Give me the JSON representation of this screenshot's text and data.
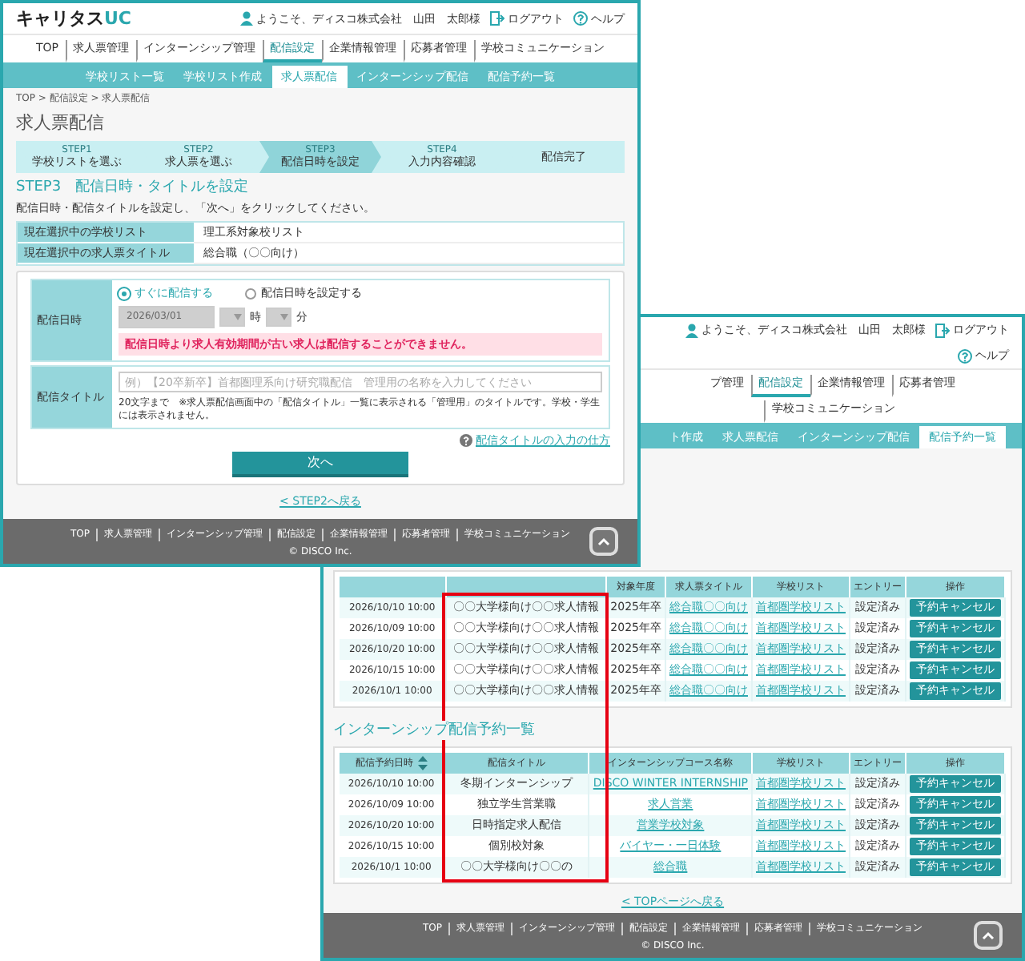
{
  "front_window": {
    "logo": {
      "main": "キャリタス",
      "accent": "UC"
    },
    "user": {
      "greeting": "ようこそ、ディスコ株式会社　山田　太郎様",
      "logout": "ログアウト",
      "help": "ヘルプ"
    },
    "nav": [
      {
        "label": "TOP",
        "selected": false
      },
      {
        "label": "求人票管理",
        "selected": false
      },
      {
        "label": "インターンシップ管理",
        "selected": false
      },
      {
        "label": "配信設定",
        "selected": true
      },
      {
        "label": "企業情報管理",
        "selected": false
      },
      {
        "label": "応募者管理",
        "selected": false
      },
      {
        "label": "学校コミュニケーション",
        "selected": false
      }
    ],
    "subtabs": [
      {
        "label": "学校リスト一覧",
        "selected": false
      },
      {
        "label": "学校リスト作成",
        "selected": false
      },
      {
        "label": "求人票配信",
        "selected": true
      },
      {
        "label": "インターンシップ配信",
        "selected": false
      },
      {
        "label": "配信予約一覧",
        "selected": false
      }
    ],
    "breadcrumb": "TOP > 配信設定 > 求人票配信",
    "title": "求人票配信",
    "steps": [
      {
        "step": "STEP1",
        "label": "学校リストを選ぶ",
        "selected": false
      },
      {
        "step": "STEP2",
        "label": "求人票を選ぶ",
        "selected": false
      },
      {
        "step": "STEP3",
        "label": "配信日時を設定",
        "selected": true
      },
      {
        "step": "STEP4",
        "label": "入力内容確認",
        "selected": false
      },
      {
        "label": "配信完了",
        "selected": false
      }
    ],
    "section_heading": "STEP3　配信日時・タイトルを設定",
    "instruction": "配信日時・配信タイトルを設定し、「次へ」をクリックしてください。",
    "summary": [
      {
        "label": "現在選択中の学校リスト",
        "value": "理工系対象校リスト"
      },
      {
        "label": "現在選択中の求人票タイトル",
        "value": "総合職（〇〇向け）"
      }
    ],
    "form": {
      "date_label": "配信日時",
      "options": [
        {
          "label": "すぐに配信する",
          "selected": true
        },
        {
          "label": "配信日時を設定する",
          "selected": false
        }
      ],
      "date_value": "2026/03/01",
      "hour_unit": "時",
      "minute_unit": "分",
      "disabled": true,
      "error": "配信日時より求人有効期間が古い求人は配信することができません。",
      "title_label": "配信タイトル",
      "title_placeholder": "例）【20卒新卒】首都圏理系向け研究職配信　管理用の名称を入力してください",
      "title_note": "20文字まで　※求人票配信画面中の「配信タイトル」一覧に表示される「管理用」のタイトルです。学校・学生には表示されません。",
      "help_link": "配信タイトルの入力の仕方",
      "submit": "次へ"
    },
    "back_link": "< STEP2へ戻る",
    "footer": {
      "links": [
        "TOP",
        "求人票管理",
        "インターンシップ管理",
        "配信設定",
        "企業情報管理",
        "応募者管理",
        "学校コミュニケーション"
      ],
      "copyright": "© DISCO Inc."
    }
  },
  "back_window": {
    "user": {
      "greeting": "ようこそ、ディスコ株式会社　山田　太郎様",
      "logout": "ログアウト",
      "help": "ヘルプ"
    },
    "nav": [
      {
        "label": "プ管理",
        "selected": false
      },
      {
        "label": "配信設定",
        "selected": true
      },
      {
        "label": "企業情報管理",
        "selected": false
      },
      {
        "label": "応募者管理",
        "selected": false
      },
      {
        "label": "学校コミュニケーション",
        "selected": false
      }
    ],
    "subtabs": [
      {
        "label": "ト作成",
        "selected": false
      },
      {
        "label": "求人票配信",
        "selected": false
      },
      {
        "label": "インターンシップ配信",
        "selected": false
      },
      {
        "label": "配信予約一覧",
        "selected": true
      }
    ],
    "job_reservations": {
      "columns": [
        "",
        "",
        "対象年度",
        "求人票タイトル",
        "学校リスト",
        "エントリー",
        "操作"
      ],
      "rows": [
        {
          "cells": [
            "2026/10/10 10:00",
            "〇〇大学様向け〇〇求人情報",
            "2025年卒",
            {
              "kind": "link",
              "text": "総合職〇〇向け"
            },
            {
              "kind": "link",
              "text": "首都圏学校リスト"
            },
            "設定済み"
          ],
          "action": "予約キャンセル"
        },
        {
          "cells": [
            "2026/10/09 10:00",
            "〇〇大学様向け〇〇求人情報",
            "2025年卒",
            {
              "kind": "link",
              "text": "総合職〇〇向け"
            },
            {
              "kind": "link",
              "text": "首都圏学校リスト"
            },
            "設定済み"
          ],
          "action": "予約キャンセル"
        },
        {
          "cells": [
            "2026/10/20 10:00",
            "〇〇大学様向け〇〇求人情報",
            "2025年卒",
            {
              "kind": "link",
              "text": "総合職〇〇向け"
            },
            {
              "kind": "link",
              "text": "首都圏学校リスト"
            },
            "設定済み"
          ],
          "action": "予約キャンセル"
        },
        {
          "cells": [
            "2026/10/15 10:00",
            "〇〇大学様向け〇〇求人情報",
            "2025年卒",
            {
              "kind": "link",
              "text": "総合職〇〇向け"
            },
            {
              "kind": "link",
              "text": "首都圏学校リスト"
            },
            "設定済み"
          ],
          "action": "予約キャンセル"
        },
        {
          "cells": [
            "2026/10/1 10:00",
            "〇〇大学様向け〇〇求人情報",
            "2025年卒",
            {
              "kind": "link",
              "text": "総合職〇〇向け"
            },
            {
              "kind": "link",
              "text": "首都圏学校リスト"
            },
            "設定済み"
          ],
          "action": "予約キャンセル"
        }
      ]
    },
    "internship_heading": "インターンシップ配信予約一覧",
    "internship_reservations": {
      "columns": [
        "配信予約日時",
        "配信タイトル",
        "インターンシップコース名称",
        "学校リスト",
        "エントリー",
        "操作"
      ],
      "rows": [
        {
          "cells": [
            "2026/10/10 10:00",
            "冬期インターンシップ",
            {
              "kind": "link",
              "text": "DISCO WINTER INTERNSHIP"
            },
            {
              "kind": "link",
              "text": "首都圏学校リスト"
            },
            "設定済み"
          ],
          "action": "予約キャンセル"
        },
        {
          "cells": [
            "2026/10/09 10:00",
            "独立学生営業職",
            {
              "kind": "link",
              "text": "求人営業"
            },
            {
              "kind": "link",
              "text": "首都圏学校リスト"
            },
            "設定済み"
          ],
          "action": "予約キャンセル"
        },
        {
          "cells": [
            "2026/10/20 10:00",
            "日時指定求人配信",
            {
              "kind": "link",
              "text": "営業学校対象"
            },
            {
              "kind": "link",
              "text": "首都圏学校リスト"
            },
            "設定済み"
          ],
          "action": "予約キャンセル"
        },
        {
          "cells": [
            "2026/10/15 10:00",
            "個別校対象",
            {
              "kind": "link",
              "text": "バイヤー・一日体験"
            },
            {
              "kind": "link",
              "text": "首都圏学校リスト"
            },
            "設定済み"
          ],
          "action": "予約キャンセル"
        },
        {
          "cells": [
            "2026/10/1 10:00",
            "〇〇大学様向け〇〇の",
            {
              "kind": "link",
              "text": "総合職"
            },
            {
              "kind": "link",
              "text": "首都圏学校リスト"
            },
            "設定済み"
          ],
          "action": "予約キャンセル"
        }
      ]
    },
    "back_link": "< TOPページへ戻る",
    "footer": {
      "links": [
        "TOP",
        "求人票管理",
        "インターンシップ管理",
        "配信設定",
        "企業情報管理",
        "応募者管理",
        "学校コミュニケーション"
      ],
      "copyright": "© DISCO Inc."
    },
    "annotation": {
      "kind": "frame"
    }
  }
}
